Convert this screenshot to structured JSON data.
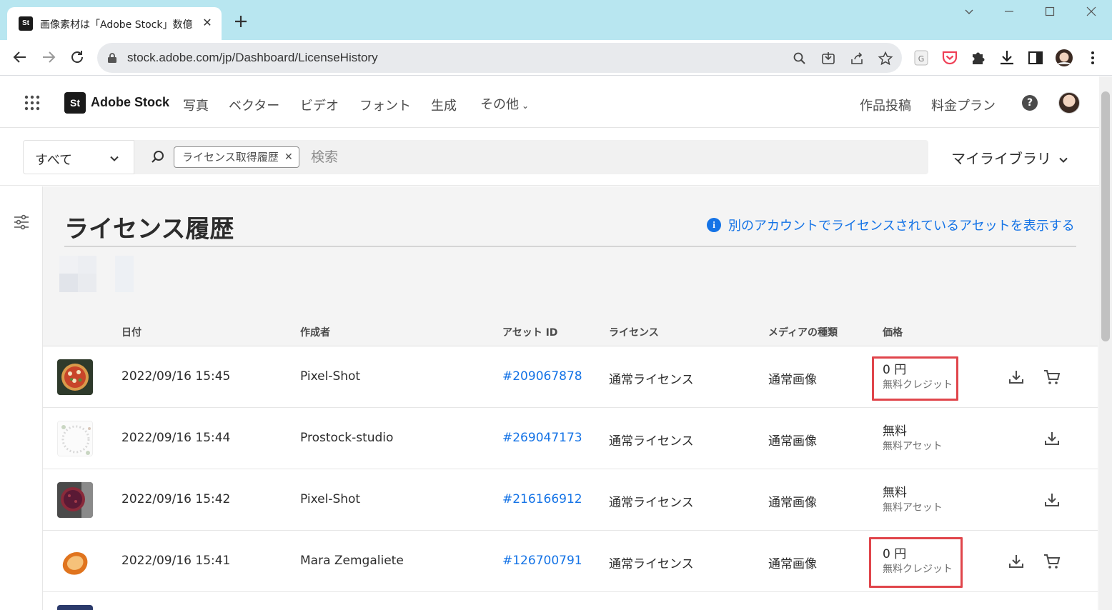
{
  "browser": {
    "tab_title": "画像素材は「Adobe Stock」数億点",
    "favicon_text": "St",
    "url": "stock.adobe.com/jp/Dashboard/LicenseHistory"
  },
  "header": {
    "logo_mark": "St",
    "logo_text": "Adobe Stock",
    "nav": [
      "写真",
      "ベクター",
      "ビデオ",
      "フォント",
      "生成",
      "その他"
    ],
    "right_links": [
      "作品投稿",
      "料金プラン"
    ],
    "help": "?"
  },
  "search": {
    "scope": "すべて",
    "chip": "ライセンス取得履歴",
    "placeholder": "検索",
    "my_library": "マイライブラリ"
  },
  "page": {
    "title": "ライセンス履歴",
    "info_link": "別のアカウントでライセンスされているアセットを表示する"
  },
  "table": {
    "headers": [
      "日付",
      "作成者",
      "アセット ID",
      "ライセンス",
      "メディアの種類",
      "価格"
    ],
    "rows": [
      {
        "date": "2022/09/16 15:45",
        "creator": "Pixel-Shot",
        "asset_id": "#209067878",
        "license": "通常ライセンス",
        "media": "通常画像",
        "price": "0 円",
        "price_note": "無料クレジット"
      },
      {
        "date": "2022/09/16 15:44",
        "creator": "Prostock-studio",
        "asset_id": "#269047173",
        "license": "通常ライセンス",
        "media": "通常画像",
        "price": "無料",
        "price_note": "無料アセット"
      },
      {
        "date": "2022/09/16 15:42",
        "creator": "Pixel-Shot",
        "asset_id": "#216166912",
        "license": "通常ライセンス",
        "media": "通常画像",
        "price": "無料",
        "price_note": "無料アセット"
      },
      {
        "date": "2022/09/16 15:41",
        "creator": "Mara Zemgaliete",
        "asset_id": "#126700791",
        "license": "通常ライセンス",
        "media": "通常画像",
        "price": "0 円",
        "price_note": "無料クレジット"
      }
    ]
  },
  "colors": {
    "accent_blue": "#1473e6",
    "highlight_red": "#e0454b",
    "tabbar": "#b8e6f0"
  }
}
